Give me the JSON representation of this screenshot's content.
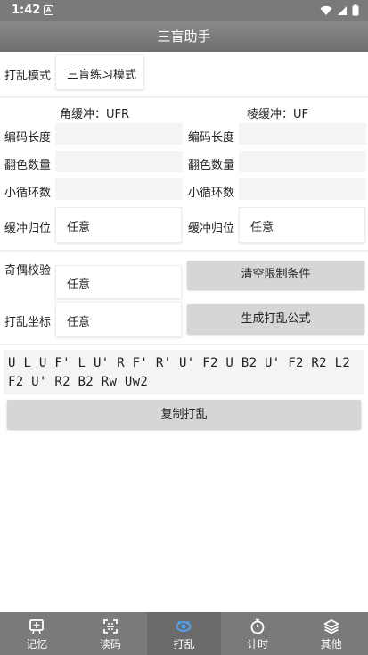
{
  "status_bar": {
    "time": "1:42",
    "notification_glyph": "A"
  },
  "app_bar": {
    "title": "三盲助手"
  },
  "scramble_mode": {
    "label": "打乱模式",
    "value": "三盲练习模式"
  },
  "buffers": {
    "corner": "角缓冲：UFR",
    "edge": "棱缓冲：UF"
  },
  "left_col": {
    "code_length_label": "编码长度",
    "flip_count_label": "翻色数量",
    "small_cycle_label": "小循环数",
    "buffer_home_label": "缓冲归位",
    "buffer_home_value": "任意"
  },
  "right_col": {
    "code_length_label": "编码长度",
    "flip_count_label": "翻色数量",
    "small_cycle_label": "小循环数",
    "buffer_home_label": "缓冲归位",
    "buffer_home_value": "任意"
  },
  "parity": {
    "label": "奇偶校验",
    "value": "任意"
  },
  "scramble_coords": {
    "label": "打乱坐标",
    "value": "任意"
  },
  "buttons": {
    "clear_limits": "清空限制条件",
    "generate": "生成打乱公式",
    "copy": "复制打乱"
  },
  "scramble_text": "U L U F' L U' R F' R' U' F2 U B2 U' F2 R2 L2 F2 U' R2 B2 Rw Uw2",
  "nav": [
    {
      "label": "记忆",
      "icon": "memory-icon",
      "active": false
    },
    {
      "label": "读码",
      "icon": "scan-icon",
      "active": false
    },
    {
      "label": "打乱",
      "icon": "scramble-icon",
      "active": true
    },
    {
      "label": "计时",
      "icon": "timer-icon",
      "active": false
    },
    {
      "label": "其他",
      "icon": "layers-icon",
      "active": false
    }
  ]
}
